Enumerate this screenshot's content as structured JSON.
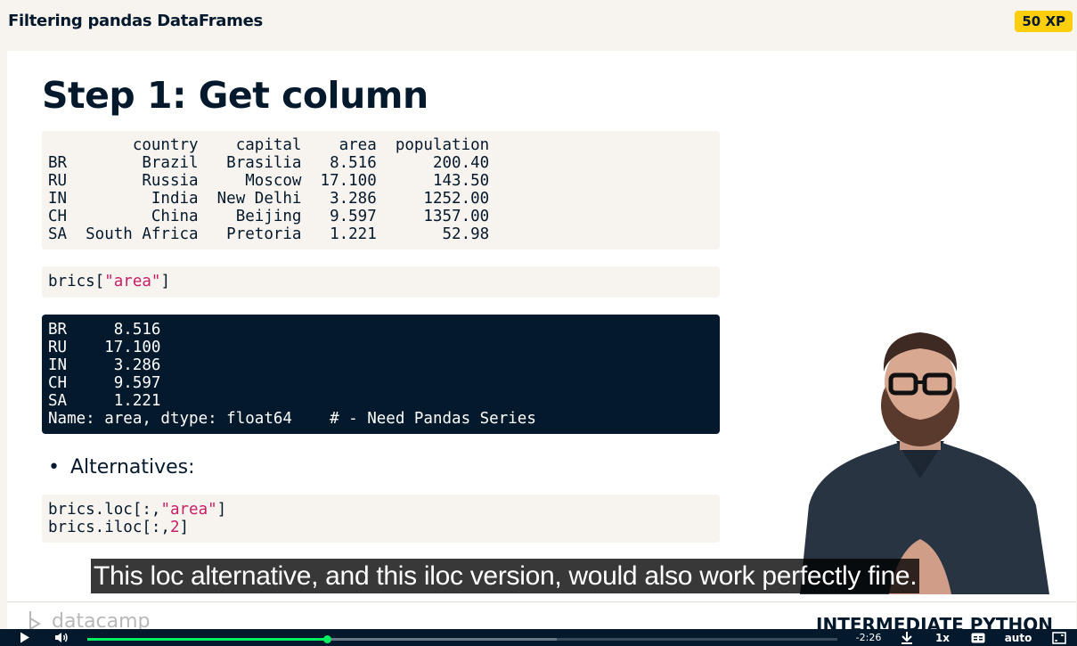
{
  "header": {
    "title": "Filtering pandas DataFrames",
    "xp_label": "50 XP"
  },
  "slide": {
    "title": "Step 1: Get column",
    "dataframe_output": "         country    capital    area  population\nBR        Brazil   Brasilia   8.516      200.40\nRU        Russia     Moscow  17.100      143.50\nIN         India  New Delhi   3.286     1252.00\nCH         China    Beijing   9.597     1357.00\nSA  South Africa   Pretoria   1.221       52.98",
    "code1": {
      "pre": "brics[",
      "str": "\"area\"",
      "post": "]"
    },
    "series_output": "BR     8.516\nRU    17.100\nIN     3.286\nCH     9.597\nSA     1.221\nName: area, dtype: float64    # - Need Pandas Series",
    "bullet_marker": "•",
    "bullet": "Alternatives:",
    "code2": {
      "line1_pre": "brics.loc[:,",
      "line1_str": "\"area\"",
      "line1_post": "]",
      "line2_pre": "brics.iloc[:,",
      "line2_num": "2",
      "line2_post": "]"
    },
    "footer_logo": "datacamp",
    "footer_course": "INTERMEDIATE PYTHON"
  },
  "subtitle": "This loc alternative, and this iloc version, would also work perfectly fine.",
  "player": {
    "time_remaining": "-2:26",
    "speed": "1x",
    "quality": "auto",
    "progress": 0.319,
    "buffered": 0.626,
    "icons": [
      "play-icon",
      "volume-icon",
      "download-icon",
      "captions-icon",
      "fullscreen-icon"
    ]
  },
  "colors": {
    "navy": "#05192d",
    "green": "#03ef62",
    "yellow": "#fcce0d",
    "string_pink": "#c71f68",
    "beige": "#f7f3ee"
  }
}
